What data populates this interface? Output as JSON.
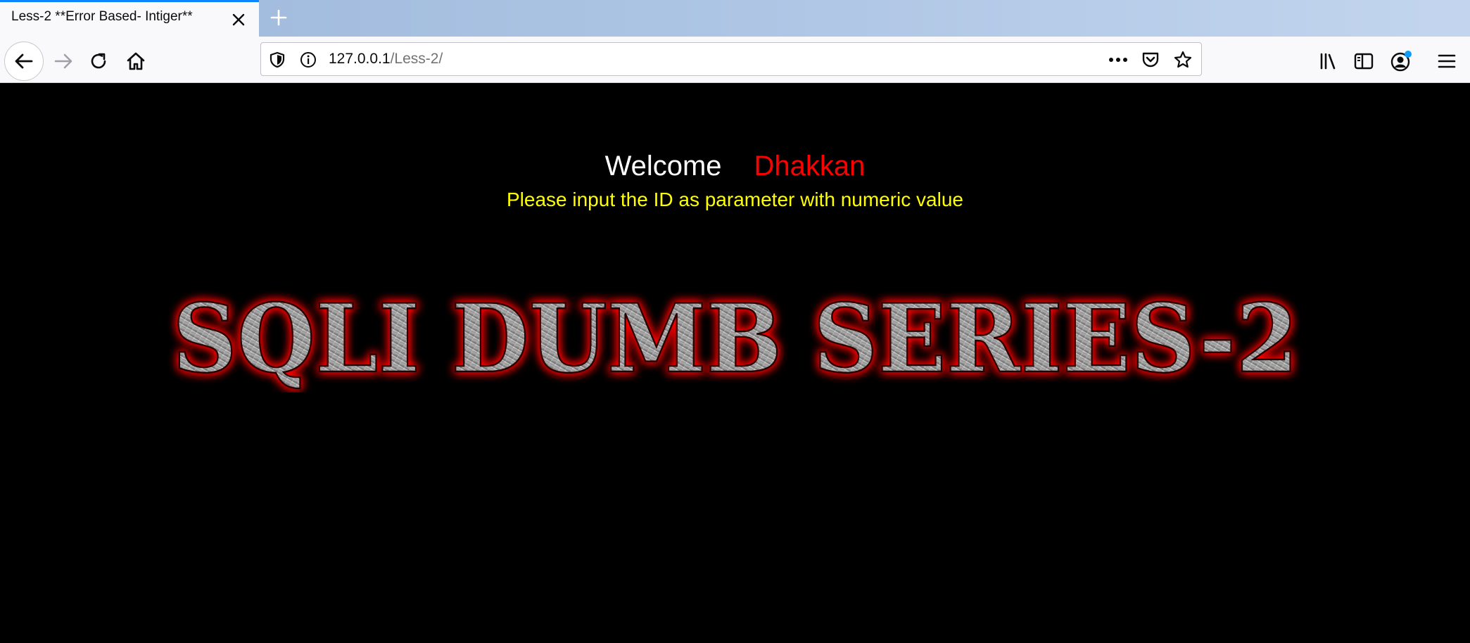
{
  "browser": {
    "tab": {
      "title": "Less-2 **Error Based- Intiger**"
    },
    "url": {
      "host": "127.0.0.1",
      "path": "/Less-2/"
    }
  },
  "page": {
    "welcome": "Welcome",
    "user": "Dhakkan",
    "hint": "Please input the ID as parameter with numeric value",
    "banner": "SQLI DUMB SERIES-2"
  },
  "colors": {
    "background": "#000000",
    "welcome": "#ffffff",
    "user": "#ff0000",
    "hint": "#ffff00",
    "banner_glow": "#ff0000",
    "tab_accent": "#0a84ff",
    "account_badge": "#0a9dff"
  },
  "icons": {
    "tab_close": "close-icon",
    "new_tab": "plus-icon",
    "back": "back-arrow-icon",
    "forward": "forward-arrow-icon",
    "reload": "reload-icon",
    "home": "home-icon",
    "tracking": "shield-icon",
    "site_info": "info-icon",
    "page_actions": "more-icon",
    "pocket": "pocket-icon",
    "bookmark": "star-icon",
    "library": "library-icon",
    "sidebars": "sidebar-icon",
    "account": "account-icon",
    "menu": "hamburger-menu-icon"
  }
}
